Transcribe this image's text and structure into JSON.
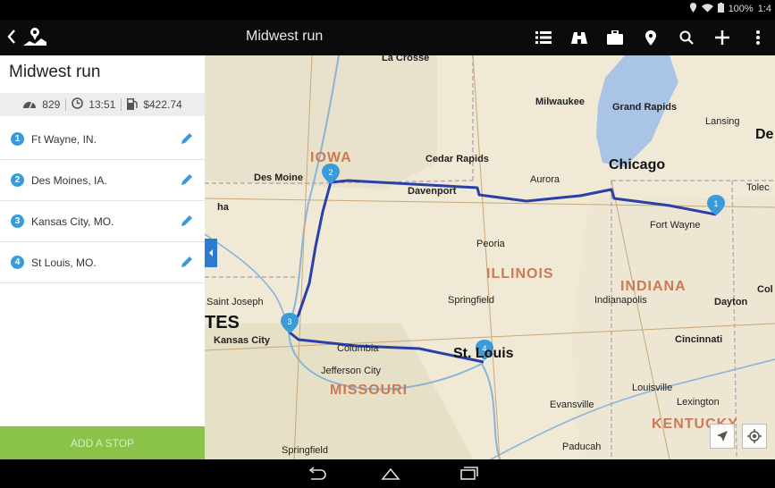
{
  "status_bar": {
    "battery": "100%",
    "time": "1:4"
  },
  "app_bar": {
    "title": "Midwest run",
    "back_icon": "chevron-left-icon",
    "logo_icon": "trip-map-icon",
    "actions": [
      {
        "name": "list-icon"
      },
      {
        "name": "binoculars-icon"
      },
      {
        "name": "briefcase-icon"
      },
      {
        "name": "map-pin-icon"
      },
      {
        "name": "search-icon"
      },
      {
        "name": "add-icon"
      },
      {
        "name": "overflow-menu-icon"
      }
    ]
  },
  "sidebar": {
    "title": "Midwest run",
    "stats": {
      "distance": "829",
      "duration": "13:51",
      "fuel_cost": "$422.74"
    },
    "stops": [
      {
        "number": "1",
        "label": "Ft Wayne, IN."
      },
      {
        "number": "2",
        "label": "Des Moines, IA."
      },
      {
        "number": "3",
        "label": "Kansas City, MO."
      },
      {
        "number": "4",
        "label": "St Louis, MO."
      }
    ],
    "add_stop_label": "ADD A STOP"
  },
  "map": {
    "city_labels": [
      "La Crosse",
      "Milwaukee",
      "Grand Rapids",
      "Lansing",
      "Cedar Rapids",
      "Des Moine",
      "Davenport",
      "Aurora",
      "Fort Wayne",
      "Tolec",
      "Peoria",
      "Springfield",
      "Indianapolis",
      "Dayton",
      "Saint Joseph",
      "Kansas City",
      "Columbia",
      "Jefferson City",
      "Cincinnati",
      "Louisville",
      "Lexington",
      "Evansville",
      "Springfield",
      "Paducah",
      "ha",
      "Col"
    ],
    "big_labels": [
      "Chicago",
      "St. Louis",
      "De",
      "TES"
    ],
    "state_labels": [
      "IOWA",
      "ILLINOIS",
      "INDIANA",
      "MISSOURI",
      "KENTUCKY"
    ],
    "markers": [
      "1",
      "2",
      "3",
      "4"
    ]
  },
  "colors": {
    "accent": "#2e7ad1",
    "add_stop": "#8bc34a",
    "route": "#2b3fa8",
    "lake": "#a9c4e4",
    "marker": "#3a9bd8"
  }
}
